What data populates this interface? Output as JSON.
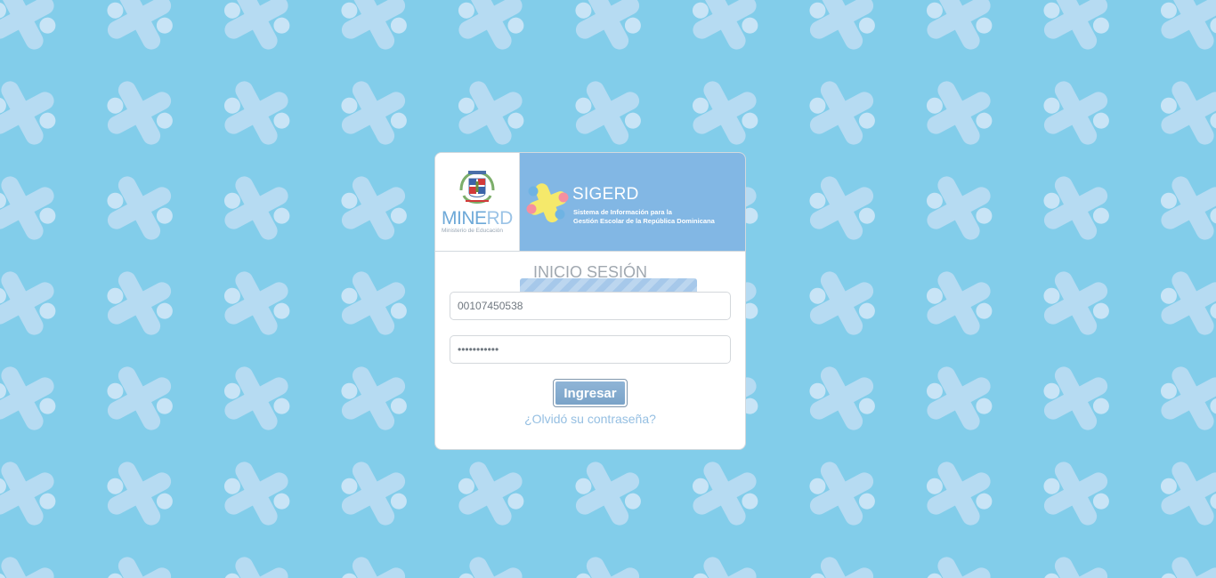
{
  "background": {
    "color": "#82cdea",
    "pattern": "plus-cross-pattern"
  },
  "header": {
    "minerd_logo": {
      "word_part1": "MINE",
      "word_part2": "RD",
      "subtitle": "Ministerio de Educación"
    },
    "sigerd_logo": {
      "title": "SIGERD",
      "subtitle_line1": "Sistema de Información para la",
      "subtitle_line2": "Gestión Escolar de la República Dominicana"
    }
  },
  "login": {
    "title": "INICIO SESIÓN",
    "username_value": "00107450538",
    "password_value": "12345678901",
    "submit_label": "Ingresar",
    "forgot_label": "¿Olvidó su contraseña?"
  },
  "colors": {
    "banner": "#82b7e4",
    "button": "#7aa3c8",
    "link": "#95bfe2"
  }
}
